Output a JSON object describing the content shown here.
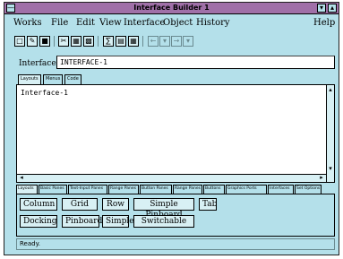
{
  "window": {
    "title": "Interface Builder 1"
  },
  "menu": [
    "Works",
    "File",
    "Edit",
    "View",
    "Interface",
    "Object",
    "History",
    "Help"
  ],
  "toolbar": {
    "icons": [
      "new-icon",
      "open-icon",
      "save-icon",
      "cut-icon",
      "copy-icon",
      "paste-icon",
      "build-icon",
      "run-icon",
      "grid-icon",
      "back-icon",
      "forward-icon"
    ]
  },
  "interface": {
    "label": "Interface:",
    "value": "INTERFACE-1"
  },
  "top_tabs": [
    "Layouts",
    "Menus",
    "Code"
  ],
  "text": {
    "content": "Interface-1"
  },
  "palette_tabs": [
    "Layouts",
    "Basic Panes",
    "Text-Input Panes",
    "Range Panes",
    "Button Panes",
    "Range Panes",
    "Buttons",
    "Graphics Ports",
    "Interfaces",
    "Set Options"
  ],
  "palette_buttons": {
    "row1": [
      "Column",
      "Grid",
      "Row",
      "Simple Pinboard",
      "Tab"
    ],
    "row2": [
      "Docking",
      "Pinboard",
      "Simple",
      "Switchable"
    ]
  },
  "status": "Ready."
}
